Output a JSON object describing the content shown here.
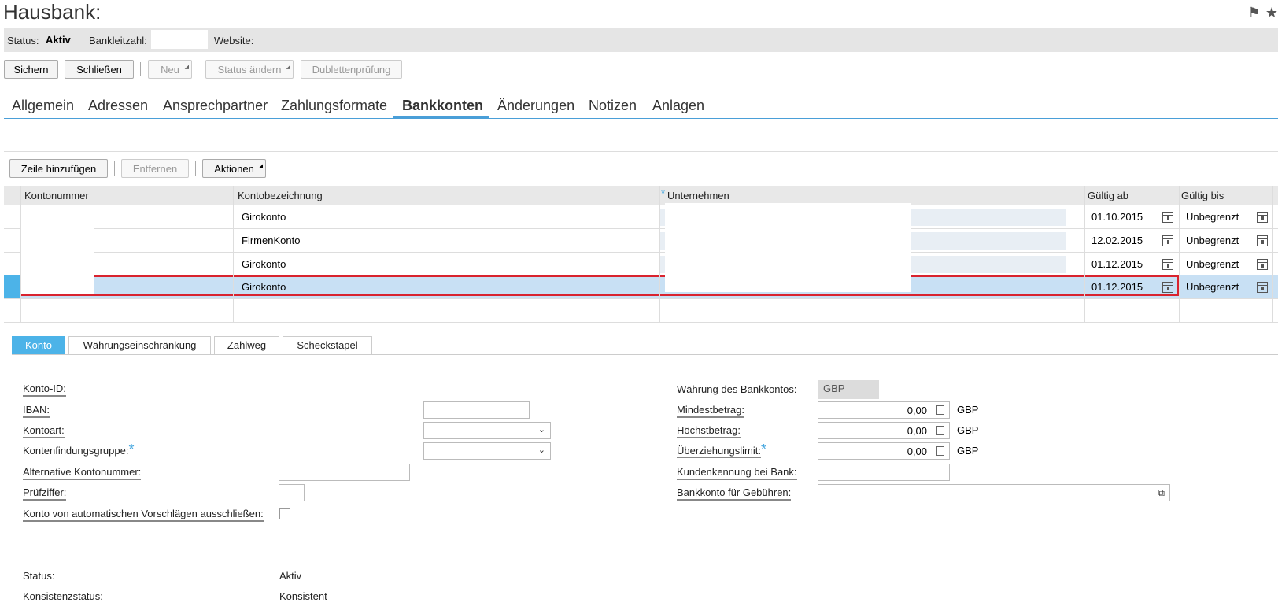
{
  "page": {
    "title": "Hausbank:"
  },
  "header_icons": [
    "flag-icon",
    "star-icon"
  ],
  "statusbar": {
    "status_label": "Status:",
    "status_value": "Aktiv",
    "blz_label": "Bankleitzahl:",
    "website_label": "Website:"
  },
  "toolbar": {
    "save": "Sichern",
    "close": "Schließen",
    "new": "Neu",
    "change_status": "Status ändern",
    "duplicate_check": "Dublettenprüfung"
  },
  "tabs": [
    "Allgemein",
    "Adressen",
    "Ansprechpartner",
    "Zahlungsformate",
    "Bankkonten",
    "Änderungen",
    "Notizen",
    "Anlagen"
  ],
  "active_tab": "Bankkonten",
  "grid_toolbar": {
    "add_row": "Zeile hinzufügen",
    "remove": "Entfernen",
    "actions": "Aktionen"
  },
  "grid": {
    "columns": [
      "Kontonummer",
      "Kontobezeichnung",
      "Unternehmen",
      "Gültig ab",
      "Gültig bis"
    ],
    "required_marker": "*",
    "rows": [
      {
        "kontobezeichnung": "Girokonto",
        "gueltig_ab": "01.10.2015",
        "gueltig_bis": "Unbegrenzt"
      },
      {
        "kontobezeichnung": "FirmenKonto",
        "gueltig_ab": "12.02.2015",
        "gueltig_bis": "Unbegrenzt"
      },
      {
        "kontobezeichnung": "Girokonto",
        "gueltig_ab": "01.12.2015",
        "gueltig_bis": "Unbegrenzt"
      },
      {
        "kontobezeichnung": "Girokonto",
        "gueltig_ab": "01.12.2015",
        "gueltig_bis": "Unbegrenzt"
      }
    ],
    "selected_row": 3
  },
  "subtabs": [
    "Konto",
    "Währungseinschränkung",
    "Zahlweg",
    "Scheckstapel"
  ],
  "active_subtab": "Konto",
  "form_left": {
    "konto_id": "Konto-ID:",
    "iban": "IBAN:",
    "kontoart": "Kontoart:",
    "kontenfindungsgruppe": "Kontenfindungsgruppe:",
    "alt_kontonummer": "Alternative Kontonummer:",
    "pruefziffer": "Prüfziffer:",
    "exclude_auto": "Konto von automatischen Vorschlägen ausschließen:",
    "status_label": "Status:",
    "status_value": "Aktiv",
    "konsistenz_label": "Konsistenzstatus:",
    "konsistenz_value": "Konsistent"
  },
  "form_right": {
    "waehrung_label": "Währung des Bankkontos:",
    "waehrung_value": "GBP",
    "mindestbetrag_label": "Mindestbetrag:",
    "mindestbetrag_value": "0,00",
    "hoechstbetrag_label": "Höchstbetrag:",
    "hoechstbetrag_value": "0,00",
    "ueberziehung_label": "Überziehungslimit:",
    "ueberziehung_value": "0,00",
    "currency": "GBP",
    "kundenkennung_label": "Kundenkennung bei Bank:",
    "gebuehren_label": "Bankkonto für Gebühren:"
  }
}
